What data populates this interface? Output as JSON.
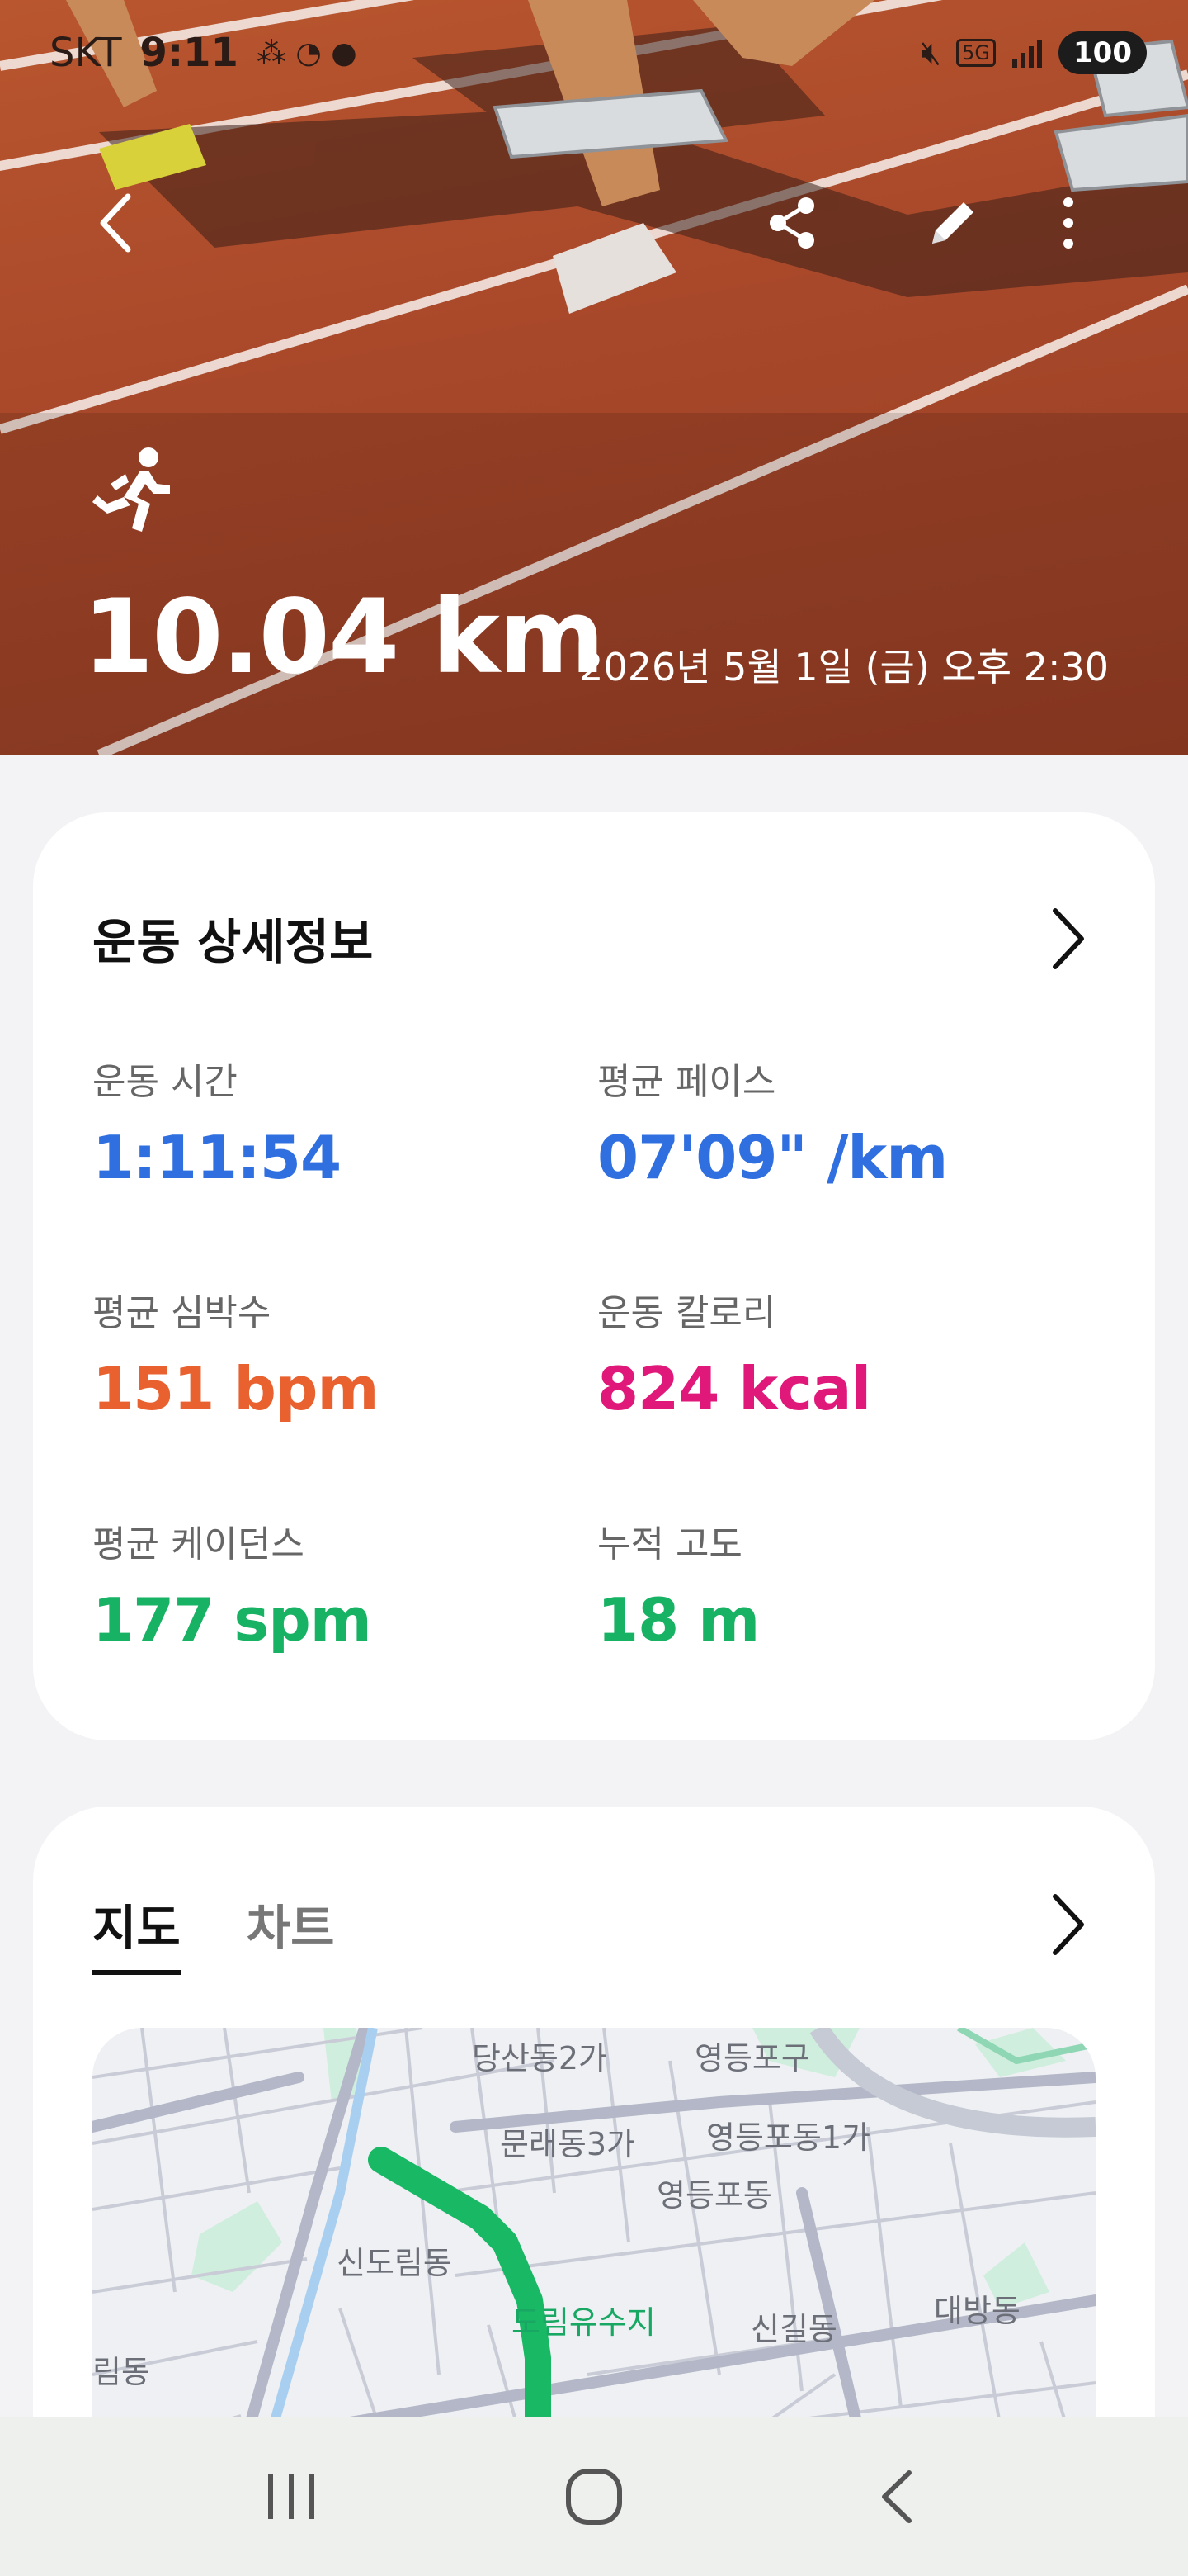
{
  "status_bar": {
    "carrier": "SKT",
    "time": "9:11",
    "network": "5G",
    "battery": "100"
  },
  "header": {
    "back_icon": "back-arrow-icon",
    "share_icon": "share-icon",
    "edit_icon": "pencil-icon",
    "more_icon": "more-vertical-icon"
  },
  "workout": {
    "activity_icon": "running-icon",
    "distance": "10.04 km",
    "datetime": "2026년 5월 1일 (금) 오후 2:30"
  },
  "details": {
    "title": "운동 상세정보",
    "metrics": [
      {
        "label": "운동 시간",
        "value": "1:11:54"
      },
      {
        "label": "평균 페이스",
        "value": "07'09\" /km"
      },
      {
        "label": "평균 심박수",
        "value": "151 bpm"
      },
      {
        "label": "운동 칼로리",
        "value": "824 kcal"
      },
      {
        "label": "평균 케이던스",
        "value": "177 spm"
      },
      {
        "label": "누적 고도",
        "value": "18 m"
      }
    ],
    "colors": {
      "blue": "#2f6fe0",
      "orange": "#e8612f",
      "pink": "#e0187a",
      "green": "#18b264"
    }
  },
  "map_section": {
    "tabs": [
      "지도",
      "차트"
    ],
    "active_tab": "지도",
    "labels": [
      "당산동2가",
      "영등포구",
      "문래동3가",
      "영등포동1가",
      "영등포동",
      "신도림동",
      "도림유수지",
      "신길동",
      "대방동",
      "림동"
    ],
    "route_color": "#19b865"
  },
  "nav": {
    "recents_icon": "recents-icon",
    "home_icon": "home-icon",
    "back_icon": "nav-back-icon"
  }
}
